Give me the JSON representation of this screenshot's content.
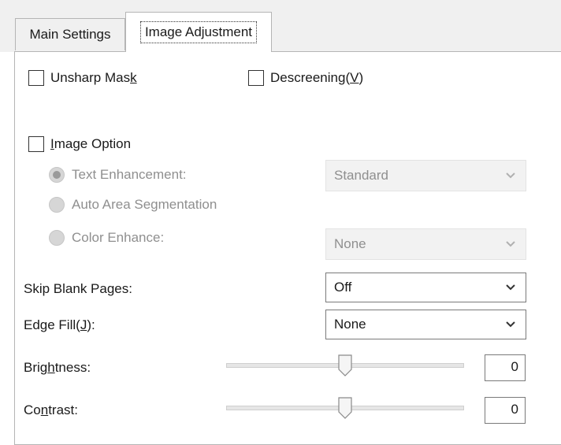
{
  "tabs": [
    {
      "label": "Main Settings"
    },
    {
      "label": "Image Adjustment"
    }
  ],
  "unsharp_mask": {
    "pre": "Unsharp Mas",
    "key": "k",
    "post": "",
    "checked": false
  },
  "descreening": {
    "pre": "Descreening(",
    "key": "V",
    "post": ")",
    "checked": false
  },
  "image_option": {
    "pre": "",
    "key": "I",
    "post": "mage Option",
    "checked": false
  },
  "text_enhancement": {
    "label": "Text Enhancement:",
    "selected": true,
    "value": "Standard"
  },
  "auto_area": {
    "label": "Auto Area Segmentation",
    "selected": false
  },
  "color_enhance": {
    "label": "Color Enhance:",
    "selected": false,
    "value": "None"
  },
  "skip_blank": {
    "label": "Skip Blank Pages:",
    "value": "Off"
  },
  "edge_fill": {
    "pre": "Edge Fill(",
    "key": "J",
    "post": "):",
    "value": "None"
  },
  "brightness": {
    "pre": "Brig",
    "key": "h",
    "post": "tness:",
    "value": "0",
    "level": 0.5
  },
  "contrast": {
    "pre": "Co",
    "key": "n",
    "post": "trast:",
    "value": "0",
    "level": 0.5
  },
  "colors": {
    "disabled_text": "#8f8f8f",
    "border": "#7a7a7a"
  }
}
